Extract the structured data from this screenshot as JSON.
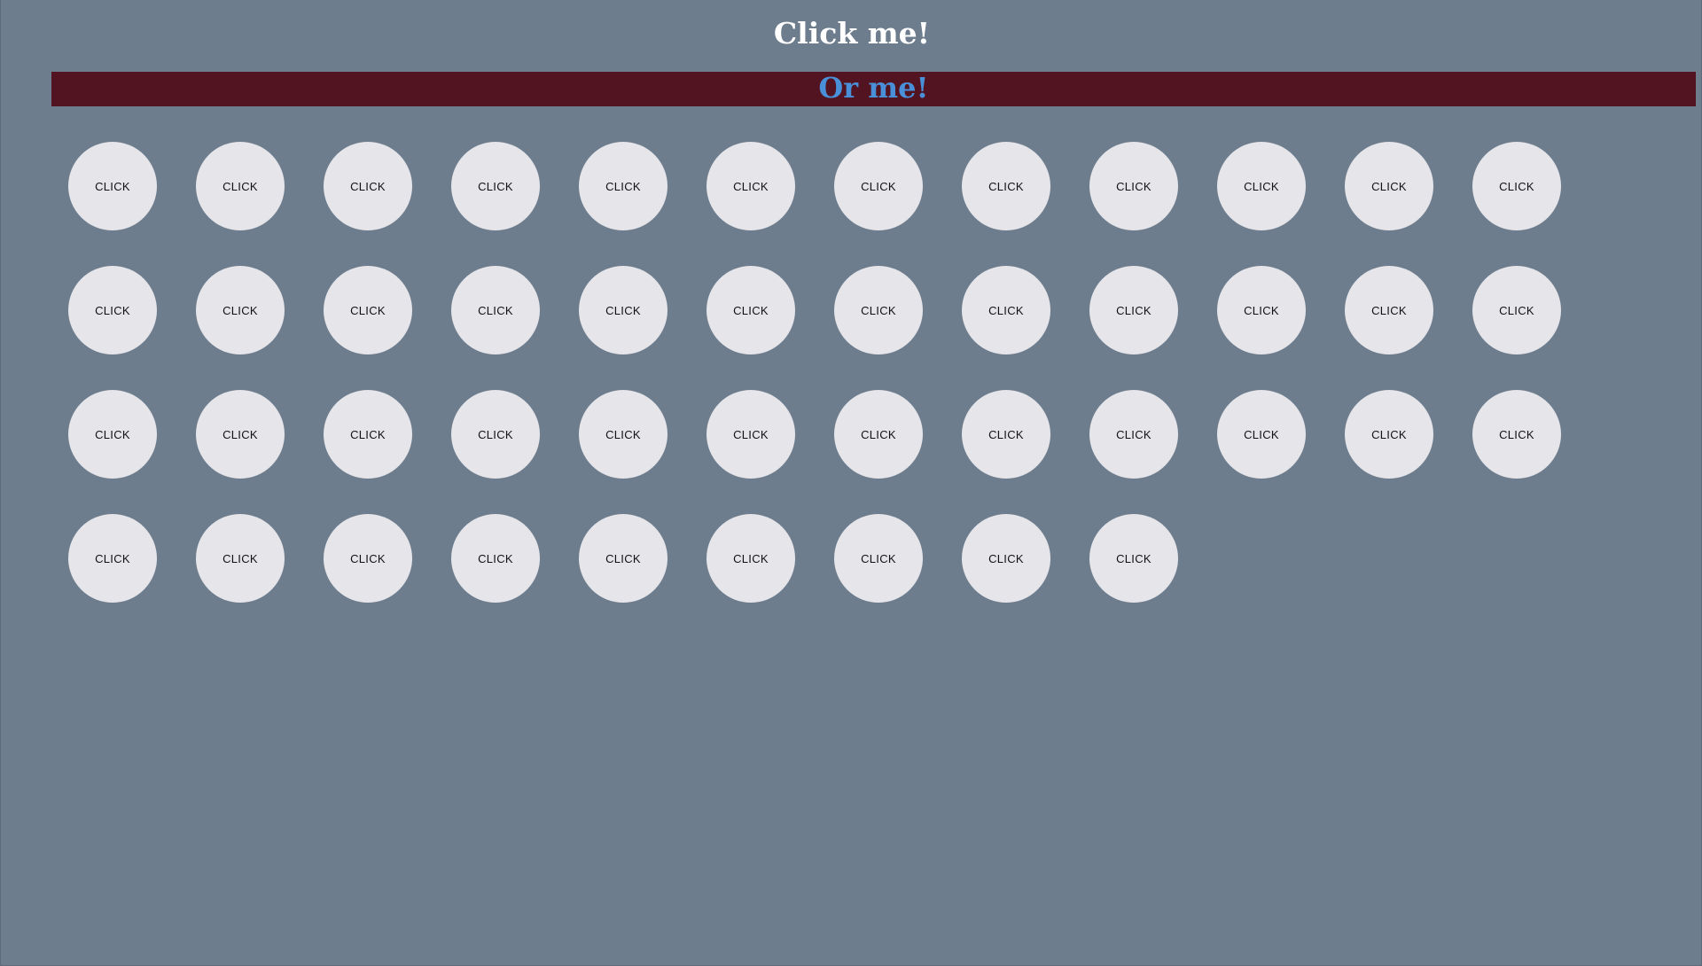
{
  "header": {
    "title": "Click me!",
    "banner_text": "Or me!"
  },
  "buttons": [
    {
      "label": "CLICK"
    },
    {
      "label": "CLICK"
    },
    {
      "label": "CLICK"
    },
    {
      "label": "CLICK"
    },
    {
      "label": "CLICK"
    },
    {
      "label": "CLICK"
    },
    {
      "label": "CLICK"
    },
    {
      "label": "CLICK"
    },
    {
      "label": "CLICK"
    },
    {
      "label": "CLICK"
    },
    {
      "label": "CLICK"
    },
    {
      "label": "CLICK"
    },
    {
      "label": "CLICK"
    },
    {
      "label": "CLICK"
    },
    {
      "label": "CLICK"
    },
    {
      "label": "CLICK"
    },
    {
      "label": "CLICK"
    },
    {
      "label": "CLICK"
    },
    {
      "label": "CLICK"
    },
    {
      "label": "CLICK"
    },
    {
      "label": "CLICK"
    },
    {
      "label": "CLICK"
    },
    {
      "label": "CLICK"
    },
    {
      "label": "CLICK"
    },
    {
      "label": "CLICK"
    },
    {
      "label": "CLICK"
    },
    {
      "label": "CLICK"
    },
    {
      "label": "CLICK"
    },
    {
      "label": "CLICK"
    },
    {
      "label": "CLICK"
    },
    {
      "label": "CLICK"
    },
    {
      "label": "CLICK"
    },
    {
      "label": "CLICK"
    },
    {
      "label": "CLICK"
    },
    {
      "label": "CLICK"
    },
    {
      "label": "CLICK"
    },
    {
      "label": "CLICK"
    },
    {
      "label": "CLICK"
    },
    {
      "label": "CLICK"
    },
    {
      "label": "CLICK"
    },
    {
      "label": "CLICK"
    },
    {
      "label": "CLICK"
    },
    {
      "label": "CLICK"
    },
    {
      "label": "CLICK"
    },
    {
      "label": "CLICK"
    }
  ],
  "colors": {
    "page_background": "#6e7d8d",
    "banner_background": "#521420",
    "banner_text": "#4a90d9",
    "title_text": "#ffffff",
    "button_background": "#e6e5ea"
  }
}
